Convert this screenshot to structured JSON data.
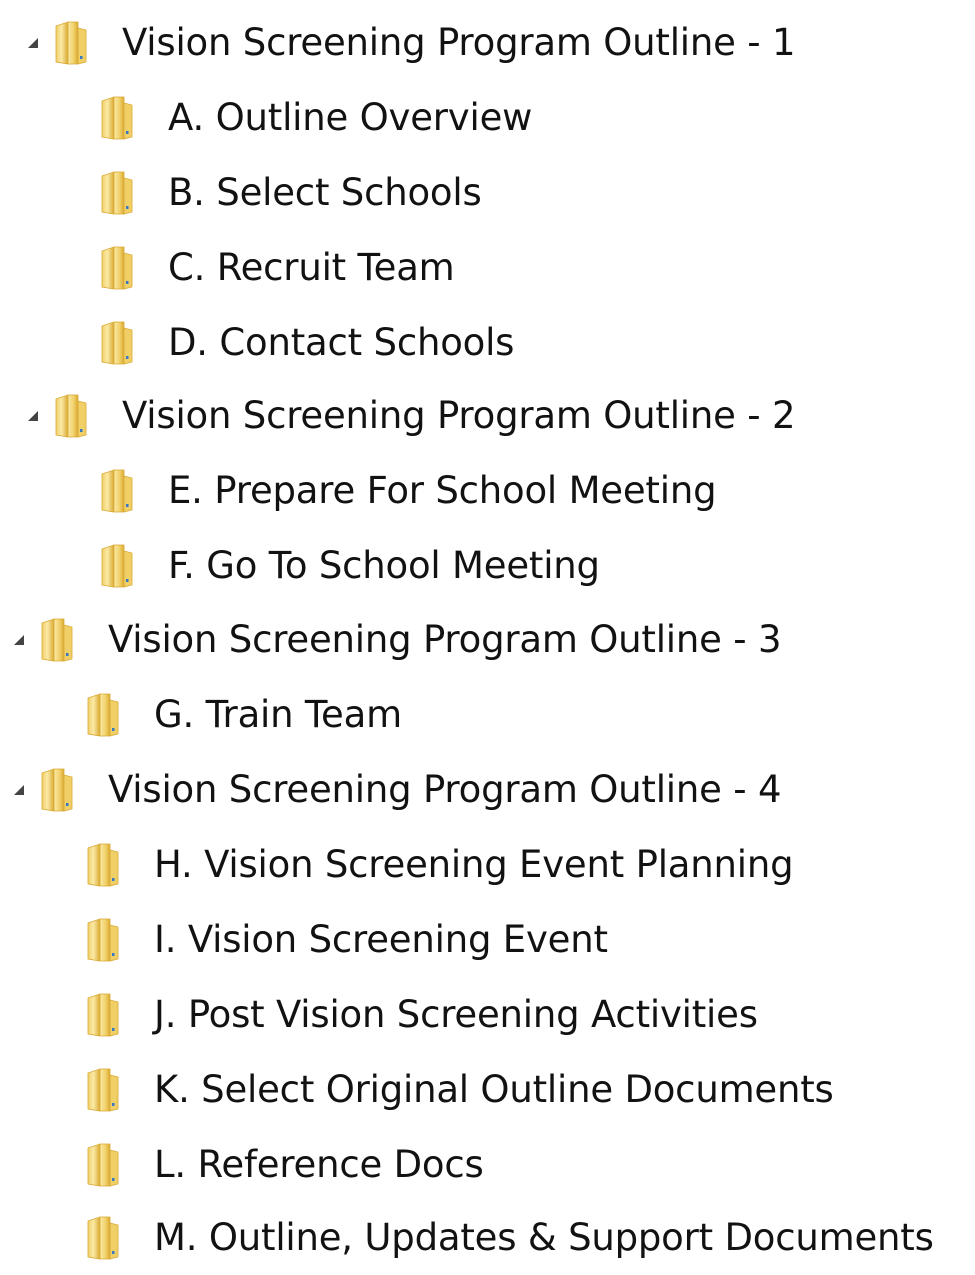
{
  "tree": [
    {
      "label": "Vision Screening Program Outline - 1",
      "expanded": true,
      "children": [
        "A. Outline Overview",
        "B.  Select Schools",
        "C.  Recruit Team",
        "D.  Contact Schools"
      ]
    },
    {
      "label": "Vision Screening Program Outline - 2",
      "expanded": true,
      "children": [
        "E.  Prepare For School Meeting",
        "F. Go To School Meeting"
      ]
    },
    {
      "label": "Vision Screening Program Outline - 3",
      "expanded": true,
      "children": [
        "G.  Train Team"
      ]
    },
    {
      "label": "Vision Screening Program Outline - 4",
      "expanded": true,
      "children": [
        "H.  Vision Screening Event Planning",
        "I.  Vision Screening Event",
        "J.  Post Vision Screening Activities",
        "K.  Select Original Outline Documents",
        "L.  Reference Docs",
        "M. Outline, Updates & Support Documents"
      ]
    }
  ],
  "icons": {
    "expand_arrow": "expanded-arrow-icon",
    "folder": "folder-icon"
  },
  "colors": {
    "text": "#121212",
    "folder_light": "#fbeaa6",
    "folder_mid": "#f0cf67",
    "folder_dark": "#d9a932",
    "arrow": "#444444",
    "background": "#ffffff"
  }
}
